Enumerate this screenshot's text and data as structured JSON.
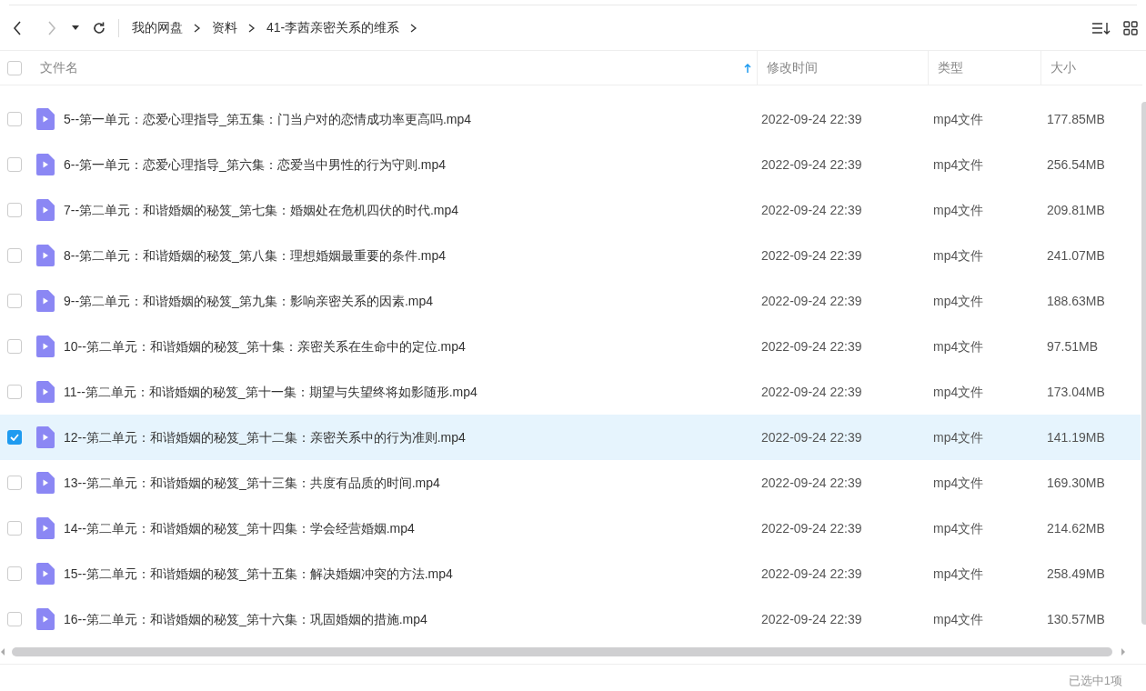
{
  "breadcrumb": [
    "我的网盘",
    "资料",
    "41-李茜亲密关系的维系"
  ],
  "table": {
    "columns": [
      {
        "label": "文件名",
        "sorted": true
      },
      {
        "label": "修改时间",
        "sorted": false
      },
      {
        "label": "类型",
        "sorted": false
      },
      {
        "label": "大小",
        "sorted": false
      }
    ],
    "all_checked": false,
    "rows": [
      {
        "name": "5--第一单元：恋爱心理指导_第五集：门当户对的恋情成功率更高吗.mp4",
        "modified": "2022-09-24 22:39",
        "type": "mp4文件",
        "size": "177.85MB",
        "selected": false
      },
      {
        "name": "6--第一单元：恋爱心理指导_第六集：恋爱当中男性的行为守则.mp4",
        "modified": "2022-09-24 22:39",
        "type": "mp4文件",
        "size": "256.54MB",
        "selected": false
      },
      {
        "name": "7--第二单元：和谐婚姻的秘笈_第七集：婚姻处在危机四伏的时代.mp4",
        "modified": "2022-09-24 22:39",
        "type": "mp4文件",
        "size": "209.81MB",
        "selected": false
      },
      {
        "name": "8--第二单元：和谐婚姻的秘笈_第八集：理想婚姻最重要的条件.mp4",
        "modified": "2022-09-24 22:39",
        "type": "mp4文件",
        "size": "241.07MB",
        "selected": false
      },
      {
        "name": "9--第二单元：和谐婚姻的秘笈_第九集：影响亲密关系的因素.mp4",
        "modified": "2022-09-24 22:39",
        "type": "mp4文件",
        "size": "188.63MB",
        "selected": false
      },
      {
        "name": "10--第二单元：和谐婚姻的秘笈_第十集：亲密关系在生命中的定位.mp4",
        "modified": "2022-09-24 22:39",
        "type": "mp4文件",
        "size": "97.51MB",
        "selected": false
      },
      {
        "name": "11--第二单元：和谐婚姻的秘笈_第十一集：期望与失望终将如影随形.mp4",
        "modified": "2022-09-24 22:39",
        "type": "mp4文件",
        "size": "173.04MB",
        "selected": false
      },
      {
        "name": "12--第二单元：和谐婚姻的秘笈_第十二集：亲密关系中的行为准则.mp4",
        "modified": "2022-09-24 22:39",
        "type": "mp4文件",
        "size": "141.19MB",
        "selected": true
      },
      {
        "name": "13--第二单元：和谐婚姻的秘笈_第十三集：共度有品质的时间.mp4",
        "modified": "2022-09-24 22:39",
        "type": "mp4文件",
        "size": "169.30MB",
        "selected": false
      },
      {
        "name": "14--第二单元：和谐婚姻的秘笈_第十四集：学会经营婚姻.mp4",
        "modified": "2022-09-24 22:39",
        "type": "mp4文件",
        "size": "214.62MB",
        "selected": false
      },
      {
        "name": "15--第二单元：和谐婚姻的秘笈_第十五集：解决婚姻冲突的方法.mp4",
        "modified": "2022-09-24 22:39",
        "type": "mp4文件",
        "size": "258.49MB",
        "selected": false
      },
      {
        "name": "16--第二单元：和谐婚姻的秘笈_第十六集：巩固婚姻的措施.mp4",
        "modified": "2022-09-24 22:39",
        "type": "mp4文件",
        "size": "130.57MB",
        "selected": false
      }
    ]
  },
  "status_bar": "已选中1项"
}
